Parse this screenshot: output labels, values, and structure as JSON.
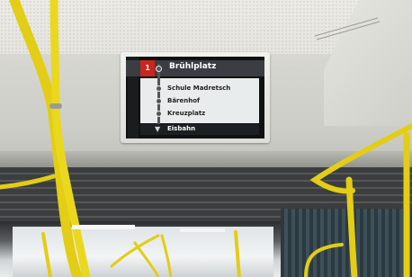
{
  "display": {
    "line_number": "1",
    "current_stop": "Brühlplatz",
    "next_stops": [
      "Schule Madretsch",
      "Bärenhof",
      "Kreuzplatz"
    ],
    "final_stop": "Eisbahn"
  },
  "colors": {
    "handrail": "#e8d21a",
    "line_badge": "#c8261f",
    "ceiling": "#ecebe6"
  }
}
